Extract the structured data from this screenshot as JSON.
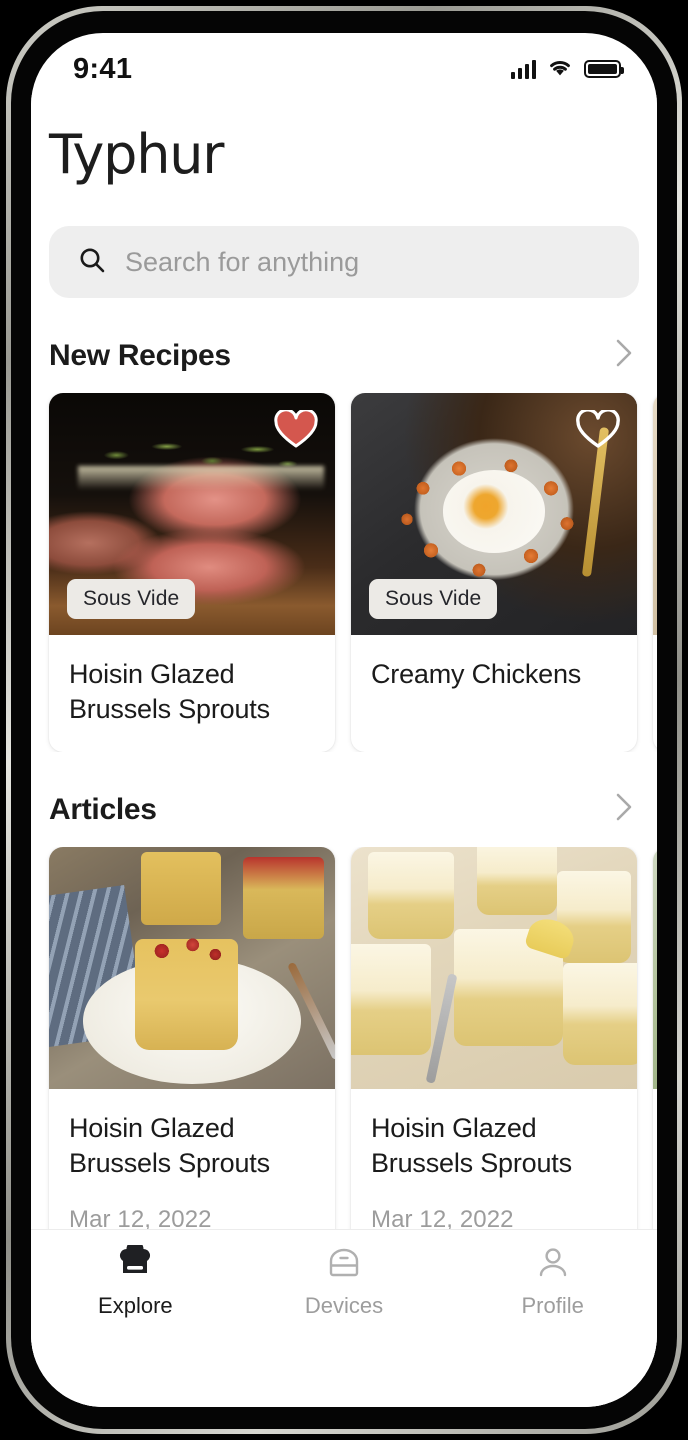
{
  "status_bar": {
    "time": "9:41",
    "signal_icon": "cellular-signal-icon",
    "wifi_icon": "wifi-icon",
    "battery_icon": "battery-full-icon"
  },
  "brand": {
    "logo_text": "Typhur"
  },
  "search": {
    "placeholder": "Search for anything",
    "value": "",
    "icon": "search-icon"
  },
  "sections": [
    {
      "title": "New Recipes",
      "see_all_icon": "chevron-right-icon",
      "cards": [
        {
          "title": "Hoisin Glazed Brussels Sprouts",
          "badge": "Sous Vide",
          "favorited": true,
          "heart_icon": "heart-filled-icon",
          "image": "sous-vide-steak-photo"
        },
        {
          "title": "Creamy Chickens",
          "badge": "Sous Vide",
          "favorited": false,
          "heart_icon": "heart-outline-icon",
          "image": "sweet-potato-hash-egg-photo"
        },
        {
          "title": "",
          "badge": "",
          "favorited": false,
          "heart_icon": "heart-outline-icon",
          "image": "partial-recipe-photo"
        }
      ]
    },
    {
      "title": "Articles",
      "see_all_icon": "chevron-right-icon",
      "cards": [
        {
          "title": "Hoisin Glazed Brussels Sprouts",
          "date": "Mar 12, 2022",
          "image": "savory-custard-jars-photo"
        },
        {
          "title": "Hoisin Glazed Brussels Sprouts",
          "date": "Mar 12, 2022",
          "image": "lemon-cheesecake-jars-photo"
        },
        {
          "title": "",
          "date": "",
          "image": "partial-article-photo"
        }
      ]
    }
  ],
  "tab_bar": {
    "items": [
      {
        "label": "Explore",
        "icon": "chef-hat-icon",
        "active": true
      },
      {
        "label": "Devices",
        "icon": "device-appliance-icon",
        "active": false
      },
      {
        "label": "Profile",
        "icon": "person-icon",
        "active": false
      }
    ]
  },
  "colors": {
    "accent_heart": "#d4574e",
    "text_primary": "#1b1b1b",
    "text_muted": "#9c9c9c",
    "search_bg": "#eeeeee"
  }
}
